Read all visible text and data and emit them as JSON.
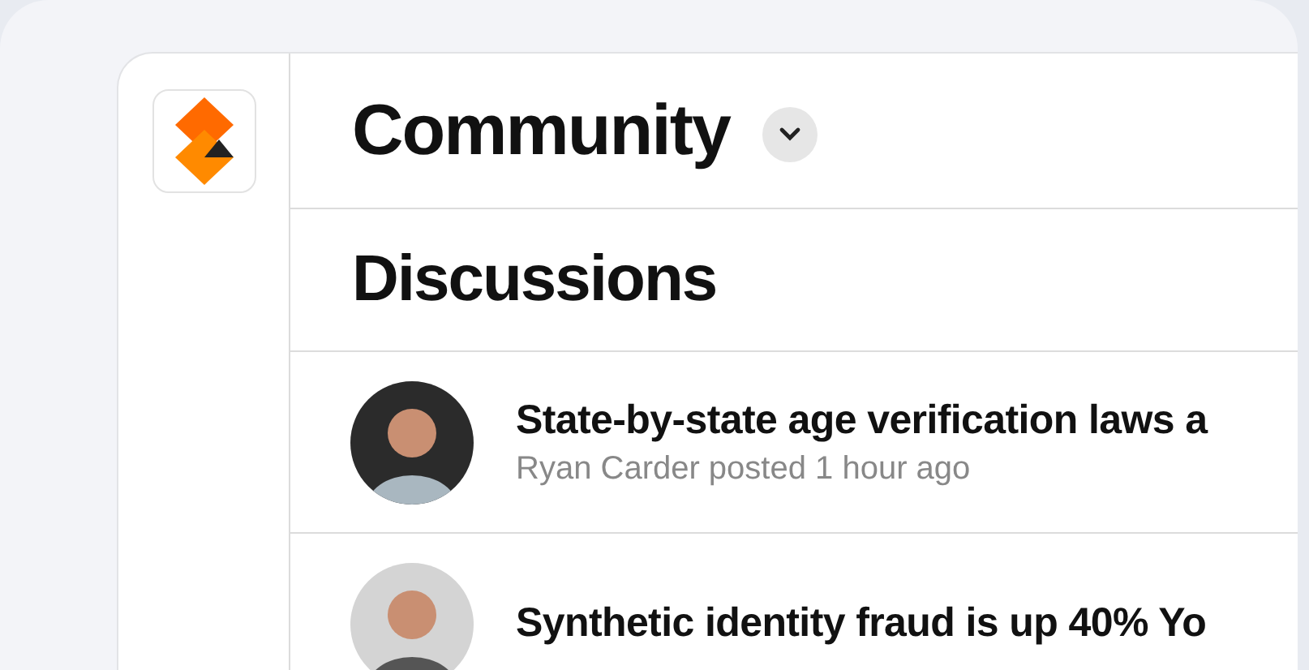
{
  "header": {
    "title": "Community"
  },
  "section": {
    "title": "Discussions"
  },
  "posts": [
    {
      "title": "State-by-state age verification laws a",
      "meta": "Ryan Carder posted 1 hour ago"
    },
    {
      "title": "Synthetic identity fraud is up 40% Yo"
    }
  ]
}
